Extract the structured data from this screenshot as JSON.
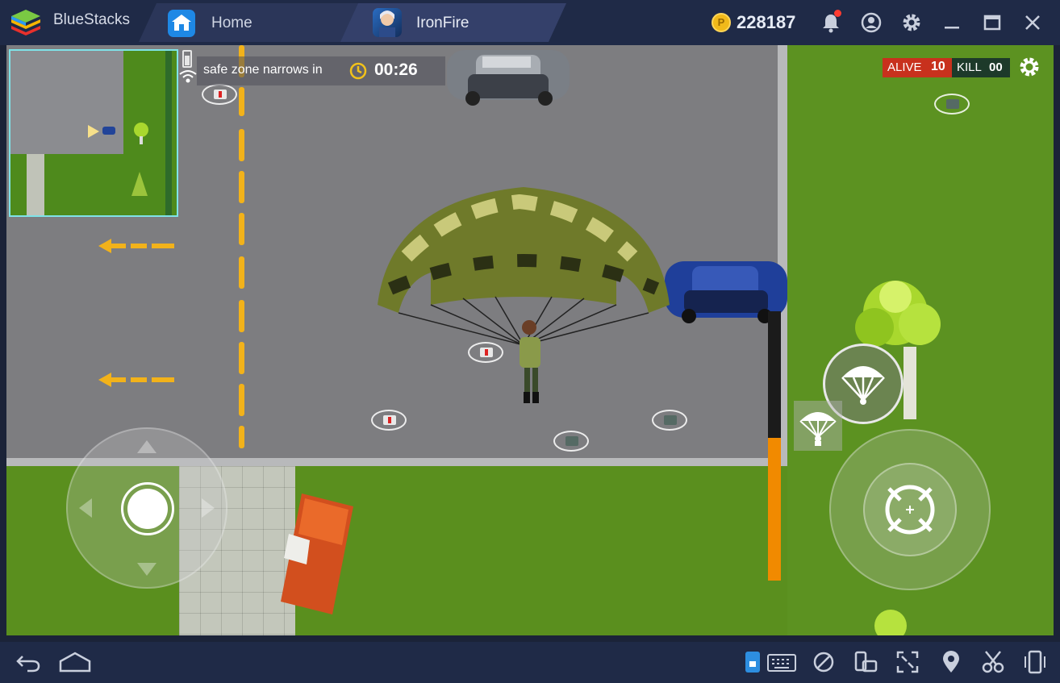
{
  "app": {
    "name": "BlueStacks",
    "coins": "228187"
  },
  "tabs": [
    {
      "label": "Home",
      "icon": "home-icon"
    },
    {
      "label": "IronFire",
      "icon": "ironfire-app-icon"
    }
  ],
  "window_controls": [
    "bell-icon",
    "account-icon",
    "gear-icon",
    "minimize-icon",
    "maximize-icon",
    "close-icon"
  ],
  "hud": {
    "zone_text": "safe zone narrows in",
    "zone_time": "00:26",
    "alive_label": "ALIVE",
    "alive_count": "10",
    "kill_label": "KILL",
    "kill_count": "00",
    "altitude_fraction": 0.53,
    "colors": {
      "alive_bg": "#c8311d",
      "kill_bg": "#1d3a2a",
      "altitude_fill": "#f18a00",
      "minimap_border": "#7fe3e8"
    }
  },
  "controls": [
    "movement-joystick",
    "parachute-button",
    "fire-button",
    "parachute-small-button"
  ],
  "bottom_nav": [
    "back-icon",
    "home-nav-icon",
    "keymapping-icon",
    "keyboard-icon",
    "eco-mode-icon",
    "rotate-icon",
    "fullscreen-icon",
    "location-icon",
    "screenshot-scissors-icon",
    "shake-device-icon"
  ],
  "theme": {
    "chrome_bg": "#1f2a47",
    "grass": "#5a8f1e",
    "road": "#7d7d80",
    "lane_yellow": "#f2b21a"
  }
}
